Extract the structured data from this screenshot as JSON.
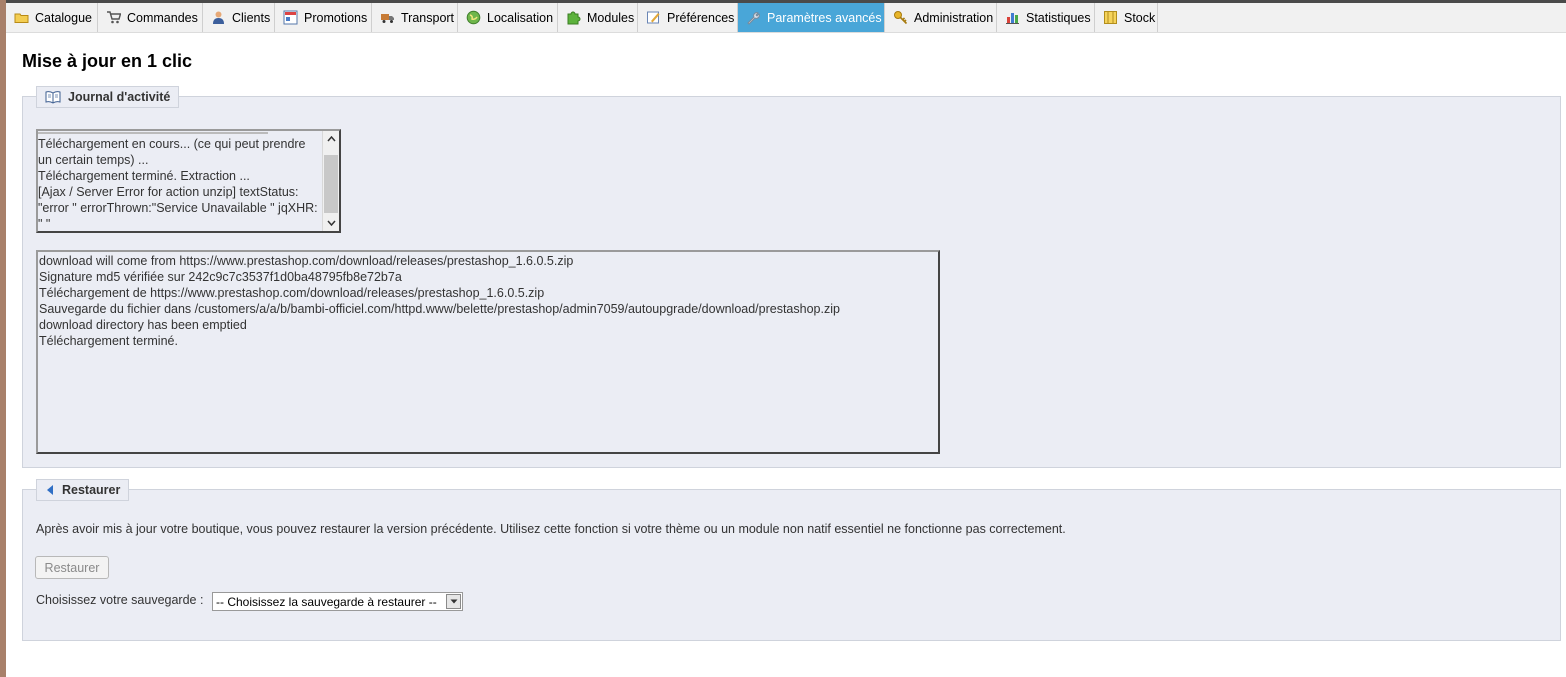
{
  "tabs": [
    {
      "label": "Catalogue",
      "icon": "folder-icon"
    },
    {
      "label": "Commandes",
      "icon": "cart-icon"
    },
    {
      "label": "Clients",
      "icon": "user-icon"
    },
    {
      "label": "Promotions",
      "icon": "promotions-icon"
    },
    {
      "label": "Transport",
      "icon": "truck-icon"
    },
    {
      "label": "Localisation",
      "icon": "globe-icon"
    },
    {
      "label": "Modules",
      "icon": "puzzle-icon"
    },
    {
      "label": "Préférences",
      "icon": "preferences-icon"
    },
    {
      "label": "Paramètres avancés",
      "icon": "wrench-icon",
      "active": true
    },
    {
      "label": "Administration",
      "icon": "key-icon"
    },
    {
      "label": "Statistiques",
      "icon": "chart-icon"
    },
    {
      "label": "Stock",
      "icon": "stock-icon"
    }
  ],
  "page_title": "Mise à jour en 1 clic",
  "journal": {
    "legend": "Journal d'activité",
    "icon": "book-icon",
    "small_log_lines": [
      "Téléchargement en cours... (ce qui peut prendre",
      "un certain temps) ...",
      "Téléchargement terminé. Extraction ...",
      "[Ajax / Server Error for action unzip] textStatus:",
      "\"error \" errorThrown:\"Service Unavailable \" jqXHR:",
      "\" \""
    ],
    "large_log_lines": [
      "download will come from https://www.prestashop.com/download/releases/prestashop_1.6.0.5.zip",
      "Signature md5 vérifiée sur 242c9c7c3537f1d0ba48795fb8e72b7a",
      "Téléchargement de https://www.prestashop.com/download/releases/prestashop_1.6.0.5.zip",
      "Sauvegarde du fichier dans /customers/a/a/b/bambi-officiel.com/httpd.www/belette/prestashop/admin7059/autoupgrade/download/prestashop.zip",
      "download directory has been emptied",
      "Téléchargement terminé."
    ]
  },
  "restore": {
    "legend": "Restaurer",
    "icon": "arrow-left-icon",
    "description": "Après avoir mis à jour votre boutique, vous pouvez restaurer la version précédente. Utilisez cette fonction si votre thème ou un module non natif essentiel ne fonctionne pas correctement.",
    "button_label": "Restaurer",
    "select_label": "Choisissez votre sauvegarde :",
    "select_value": "-- Choisissez la sauvegarde à restaurer --"
  },
  "colors": {
    "active_tab": "#49a6d8",
    "panel_bg": "#ebedf4",
    "panel_border": "#cfd3dc"
  }
}
